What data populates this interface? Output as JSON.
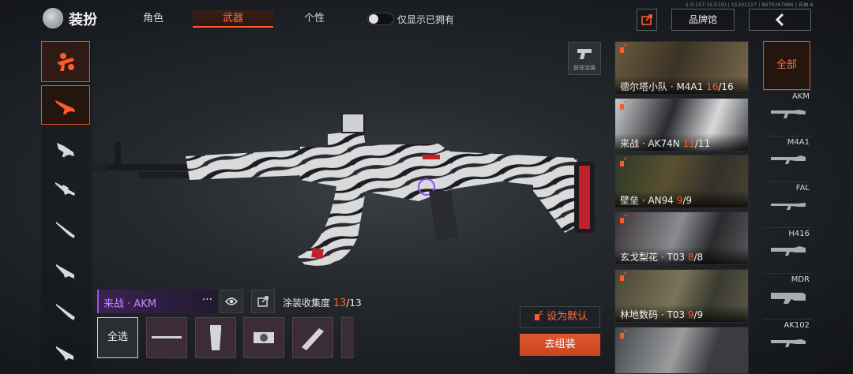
{
  "version_text": "1.0.157.157(10) | 01301217 | 8670367986 | 自由-6",
  "header": {
    "title": "装扮",
    "tabs": [
      {
        "label": "角色",
        "active": false
      },
      {
        "label": "武器",
        "active": true
      },
      {
        "label": "个性",
        "active": false
      }
    ],
    "owned_only_label": "仅显示已拥有",
    "owned_only_enabled": false,
    "brand_hall_label": "品牌馆"
  },
  "sidebar": {
    "items": [
      {
        "icon": "weapon-category-icon"
      },
      {
        "icon": "assault-rifle-icon",
        "active": true
      },
      {
        "icon": "smg-icon"
      },
      {
        "icon": "sniper-rifle-icon"
      },
      {
        "icon": "marksman-rifle-icon"
      },
      {
        "icon": "lmg-icon"
      },
      {
        "icon": "shotgun-icon"
      },
      {
        "icon": "pistol-icon"
      }
    ]
  },
  "weapon": {
    "goto_paint_label": "前往涂装",
    "name": "来战 · AKM",
    "more": "···",
    "collection_label": "涂装收集度",
    "collection_current": "13",
    "collection_total": "/13",
    "select_all_label": "全选",
    "set_default_label": "设为默认",
    "assemble_label": "去组装"
  },
  "skins": [
    {
      "name": "德尔塔小队 · M4A1",
      "have": "16",
      "total": "/16"
    },
    {
      "name": "来战 · AK74N",
      "have": "11",
      "total": "/11"
    },
    {
      "name": "壁垒 · AN94",
      "have": "9",
      "total": "/9"
    },
    {
      "name": "玄戈梨花 · T03",
      "have": "8",
      "total": "/8"
    },
    {
      "name": "林地数码 · T03",
      "have": "9",
      "total": "/9"
    },
    {
      "name": "",
      "have": "",
      "total": ""
    }
  ],
  "weapon_types": {
    "all_label": "全部",
    "items": [
      "AKM",
      "M4A1",
      "FAL",
      "H416",
      "MDR",
      "AK102"
    ]
  },
  "colors": {
    "accent": "#ff5a2a",
    "rarity": "#a24dff"
  }
}
